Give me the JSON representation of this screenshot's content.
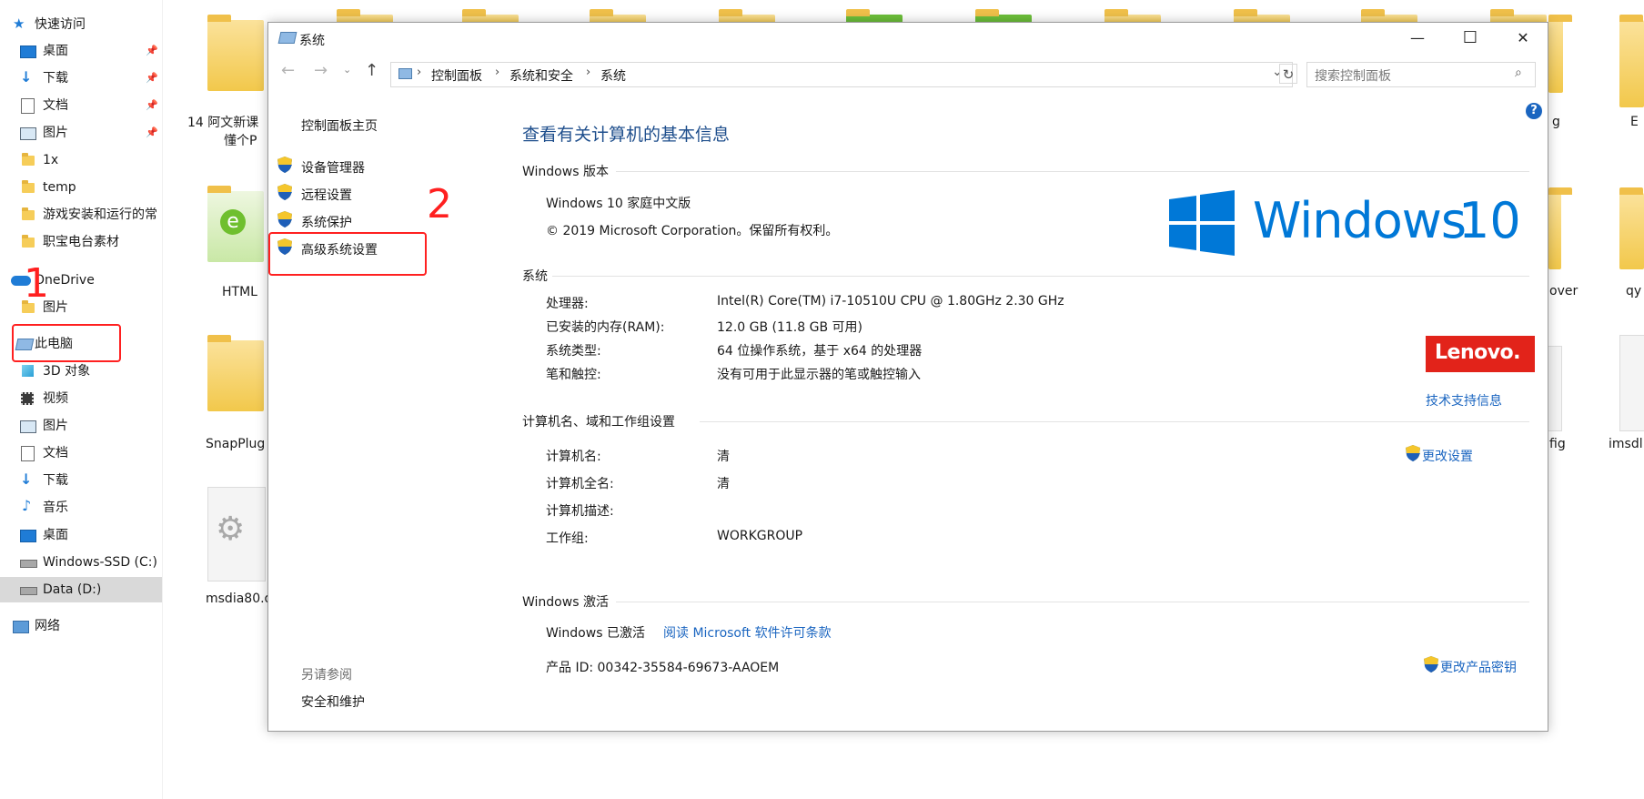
{
  "nav": {
    "quick_access": "快速访问",
    "items": [
      {
        "label": "桌面",
        "icon": "desktop-icon",
        "pinned": true
      },
      {
        "label": "下载",
        "icon": "download-icon",
        "pinned": true
      },
      {
        "label": "文档",
        "icon": "document-icon",
        "pinned": true
      },
      {
        "label": "图片",
        "icon": "picture-icon",
        "pinned": true
      },
      {
        "label": "1x",
        "icon": "folder-icon"
      },
      {
        "label": "temp",
        "icon": "folder-icon"
      },
      {
        "label": "游戏安装和运行的常",
        "icon": "folder-icon"
      },
      {
        "label": "职宝电台素材",
        "icon": "folder-icon"
      }
    ],
    "onedrive": "OneDrive",
    "onedrive_pictures": "图片",
    "this_pc": "此电脑",
    "pc_items": [
      {
        "label": "3D 对象",
        "icon": "cube-icon"
      },
      {
        "label": "视频",
        "icon": "video-icon"
      },
      {
        "label": "图片",
        "icon": "picture-icon"
      },
      {
        "label": "文档",
        "icon": "document-icon"
      },
      {
        "label": "下载",
        "icon": "download-icon"
      },
      {
        "label": "音乐",
        "icon": "music-icon"
      },
      {
        "label": "桌面",
        "icon": "desktop-icon"
      },
      {
        "label": "Windows-SSD (C:)",
        "icon": "drive-icon"
      },
      {
        "label": "Data (D:)",
        "icon": "drive-icon",
        "selected": true
      }
    ],
    "network": "网络"
  },
  "files": {
    "names": [
      "14 阿文新课",
      "懂个P",
      "HTML",
      "SnapPlug",
      "msdia80.d",
      "g",
      "over",
      "fig",
      "qy",
      "imsdl",
      "E"
    ]
  },
  "window": {
    "title": "系统",
    "minimize": "—",
    "maximize": "☐",
    "close": "✕",
    "breadcrumb": [
      "控制面板",
      "系统和安全",
      "系统"
    ],
    "search_placeholder": "搜索控制面板",
    "help": "?",
    "left_home": "控制面板主页",
    "left_links": [
      "设备管理器",
      "远程设置",
      "系统保护",
      "高级系统设置"
    ],
    "see_also_title": "另请参阅",
    "see_also": "安全和维护",
    "heading": "查看有关计算机的基本信息",
    "edition_title": "Windows 版本",
    "edition": "Windows 10 家庭中文版",
    "copyright": "© 2019 Microsoft Corporation。保留所有权利。",
    "win_logo_text": "Windows",
    "win_logo_num": "10",
    "system_title": "系统",
    "system_rows": [
      {
        "label": "处理器:",
        "value": "Intel(R) Core(TM) i7-10510U CPU @ 1.80GHz   2.30 GHz"
      },
      {
        "label": "已安装的内存(RAM):",
        "value": "12.0 GB (11.8 GB 可用)"
      },
      {
        "label": "系统类型:",
        "value": "64 位操作系统，基于 x64 的处理器"
      },
      {
        "label": "笔和触控:",
        "value": "没有可用于此显示器的笔或触控输入"
      }
    ],
    "lenovo": "Lenovo.",
    "support_link": "技术支持信息",
    "computer_title": "计算机名、域和工作组设置",
    "computer_rows": [
      {
        "label": "计算机名:",
        "value": "清"
      },
      {
        "label": "计算机全名:",
        "value": "清"
      },
      {
        "label": "计算机描述:",
        "value": ""
      },
      {
        "label": "工作组:",
        "value": "WORKGROUP"
      }
    ],
    "change_settings": "更改设置",
    "activation_title": "Windows 激活",
    "activated": "Windows 已激活",
    "license_link": "阅读 Microsoft 软件许可条款",
    "product_id": "产品 ID: 00342-35584-69673-AAOEM",
    "change_key": "更改产品密钥"
  },
  "annotations": {
    "one": "1",
    "two": "2"
  },
  "colors": {
    "accent": "#1a65c0",
    "heading": "#1e4e8c",
    "windows_blue": "#0078d7",
    "lenovo": "#e2231a",
    "annotation": "#ff2020"
  }
}
